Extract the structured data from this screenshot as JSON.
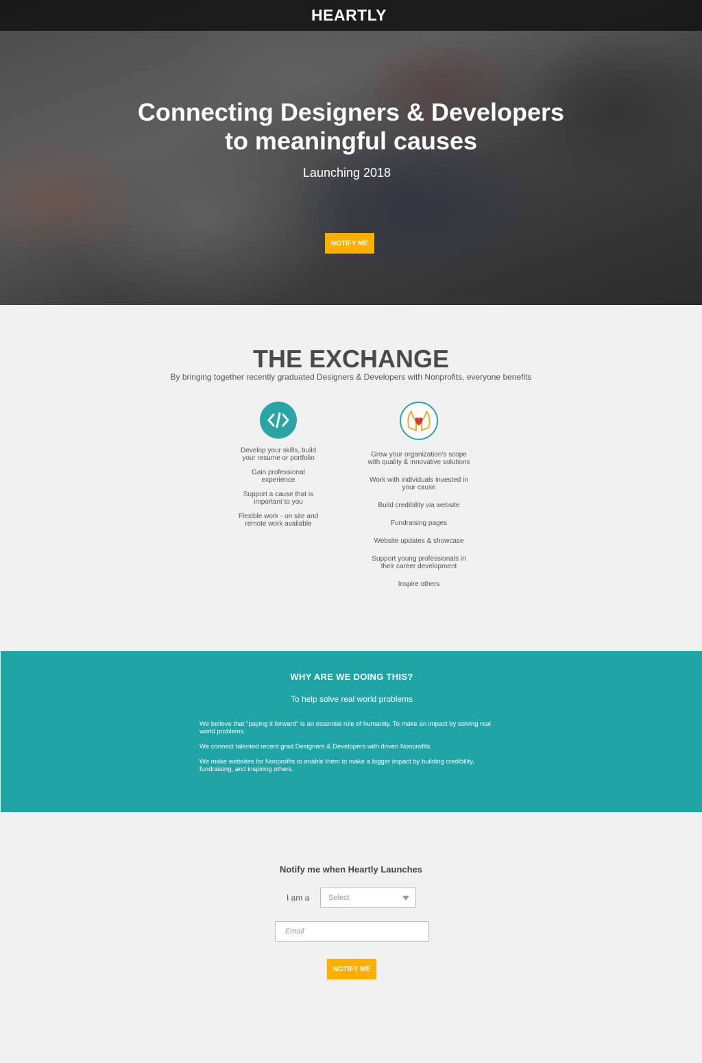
{
  "header": {
    "brand": "HEARTLY"
  },
  "hero": {
    "title_line1": "Connecting Designers & Developers",
    "title_line2": "to meaningful causes",
    "subtitle": "Launching 2018",
    "cta_label": "NOTIFY ME"
  },
  "exchange": {
    "title": "THE EXCHANGE",
    "subtitle": "By bringing together recently graduated Designers & Developers with Nonprofits, everyone benefits",
    "developers": {
      "icon": "code-icon",
      "items": [
        "Develop your skills, build your resume or portfolio",
        "Gain professional experience",
        "Support a cause that is important to you",
        "Flexible work - on site and remote work available"
      ]
    },
    "nonprofits": {
      "icon": "heart-hands-icon",
      "items": [
        "Grow your organization's scope with quality & innovative solutions",
        "Work with individuals invested in your cause",
        "Build credibility via website",
        "Fundraising pages",
        "Website updates & showcase",
        "Support young professionals in their career development",
        "Inspire others"
      ]
    }
  },
  "why": {
    "title": "WHY ARE WE DOING THIS?",
    "subtitle": "To help solve real world problems",
    "paragraphs": [
      "We believe that \"paying it forward\" is an essential rule of humanity. To make an impact by solving real world problems.",
      "We connect talented recent grad Designers & Developers with driven Nonprofits.",
      "We make websites for Nonprofits to enable them to make a bigger impact by building credibility, fundraising, and inspiring others."
    ]
  },
  "notify": {
    "title": "Notify me when Heartly Launches",
    "role_label": "I am a",
    "role_select_value": "Select",
    "email_placeholder": "Email",
    "submit_label": "NOTIFY ME"
  },
  "colors": {
    "accent": "#ffaf00",
    "teal": "#21a4a5",
    "background": "#f1f1f1"
  }
}
